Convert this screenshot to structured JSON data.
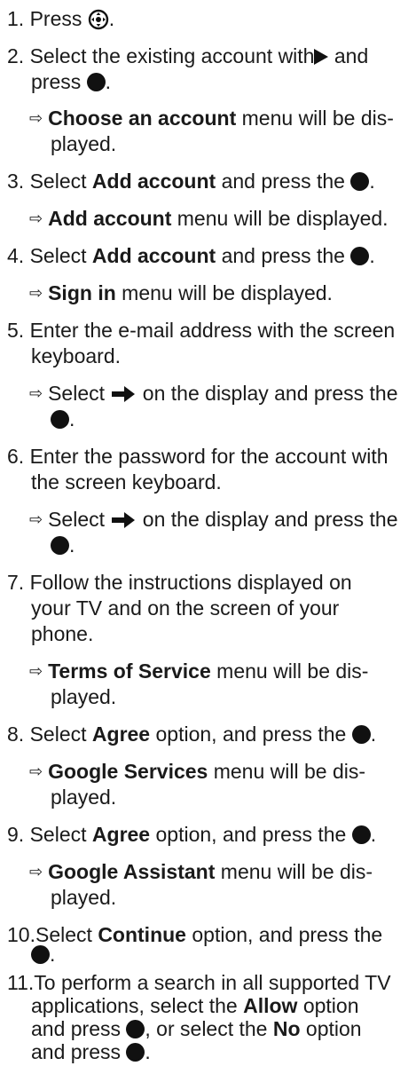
{
  "colors": {
    "text": "#1a1a1a",
    "icon": "#111111",
    "background": "#ffffff"
  },
  "icons": {
    "navigation_pad": "navigation-pad-icon",
    "ok_button": "ok-button-icon",
    "right_button": "play-right-icon",
    "forward_arrow": "right-arrow-icon",
    "result_marker": "result-arrow-icon"
  },
  "result_arrow_glyph": "⇨",
  "steps": [
    {
      "number": "1.",
      "text_a": "Press ",
      "text_b": "."
    },
    {
      "number": "2.",
      "line1": "Select the existing account with",
      "line1_b": " and",
      "line2": "press ",
      "line2_b": "."
    },
    {
      "line1_bold": "Choose an account",
      "line1": " menu will be dis-",
      "line2": "played."
    },
    {
      "number": "3.",
      "text_a": "Select ",
      "bold": "Add account",
      "text_b": " and press the ",
      "text_c": "."
    },
    {
      "bold": "Add account",
      "text": " menu will be displayed."
    },
    {
      "number": "4.",
      "text_a": "Select ",
      "bold": "Add account",
      "text_b": " and press the ",
      "text_c": "."
    },
    {
      "bold": "Sign in",
      "text": " menu will be displayed."
    },
    {
      "number": "5.",
      "line1": "Enter the e-mail address with the screen",
      "line2": "keyboard."
    },
    {
      "line1_a": "Select ",
      "line1_b": " on the display and press the",
      "line2": "."
    },
    {
      "number": "6.",
      "line1": "Enter the password for the account with",
      "line2": "the screen keyboard."
    },
    {
      "line1_a": "Select ",
      "line1_b": " on the display and press the",
      "line2": "."
    },
    {
      "number": "7.",
      "line1": "Follow the instructions displayed on",
      "line2": "your TV and on the screen of your",
      "line3": "phone."
    },
    {
      "line1_bold": "Terms of Service",
      "line1": " menu will be dis-",
      "line2": "played."
    },
    {
      "number": "8.",
      "text_a": "Select ",
      "bold": "Agree",
      "text_b": " option, and press the ",
      "text_c": "."
    },
    {
      "line1_bold": "Google Services",
      "line1": " menu will be dis-",
      "line2": "played."
    },
    {
      "number": "9.",
      "text_a": "Select ",
      "bold": "Agree",
      "text_b": " option, and press the ",
      "text_c": "."
    },
    {
      "line1_bold": "Google Assistant",
      "line1": " menu will be dis-",
      "line2": "played."
    },
    {
      "number": "10.",
      "text_a": "Select ",
      "bold": "Continue",
      "text_b": " option, and press the",
      "line2": "."
    },
    {
      "number": "11.",
      "line1": "To perform a search in all supported TV",
      "line2_a": "applications, select the ",
      "line2_bold": "Allow",
      "line2_b": " option",
      "line3_a": "and press ",
      "line3_b": ", or select the ",
      "line3_bold": "No",
      "line3_c": " option",
      "line4_a": "and press ",
      "line4_b": "."
    }
  ]
}
